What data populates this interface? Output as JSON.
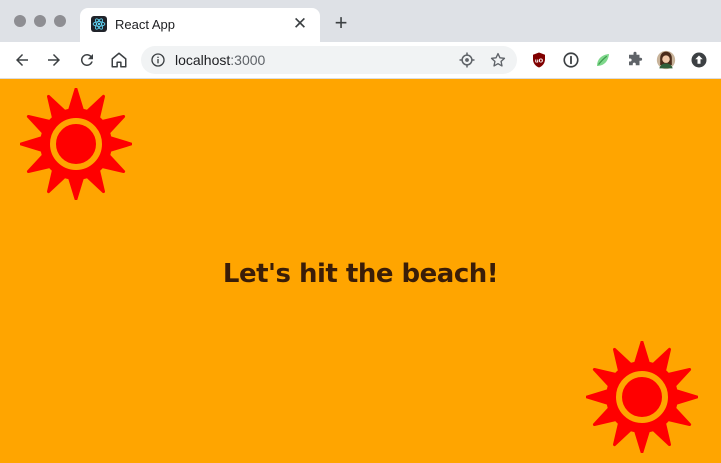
{
  "browser": {
    "tab": {
      "title": "React App",
      "favicon": "react-logo-icon",
      "close_symbol": "✕"
    },
    "new_tab_symbol": "+",
    "toolbar": {
      "back": "arrow-left-icon",
      "forward": "arrow-right-icon",
      "reload": "reload-icon",
      "home": "home-icon"
    },
    "omnibox": {
      "host": "localhost",
      "port": ":3000",
      "info_icon": "info-icon",
      "location_icon": "location-target-icon",
      "bookmark_icon": "star-icon"
    },
    "extensions": [
      "ublock-origin-icon",
      "onepassword-icon",
      "leaf-extension-icon",
      "puzzle-extensions-icon",
      "profile-avatar",
      "update-arrow-icon"
    ]
  },
  "page": {
    "background_color": "#ffa500",
    "heading": "Let's hit the beach!",
    "heading_color": "#3a1d08",
    "sun_colors": {
      "body": "#ff0000",
      "ring": "#ffa500"
    }
  }
}
